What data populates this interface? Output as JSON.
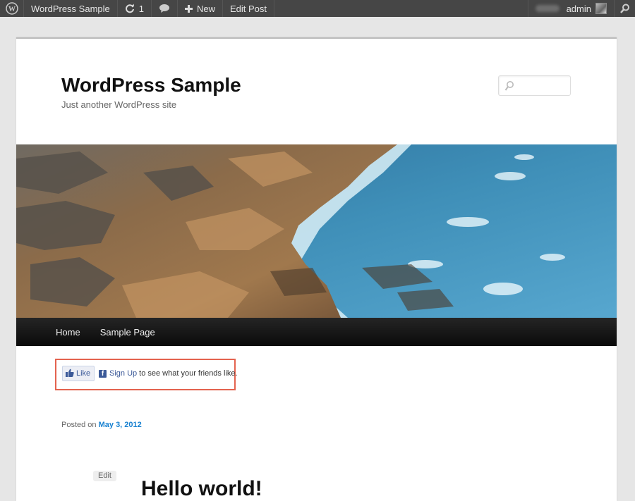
{
  "adminbar": {
    "logo_icon": "wordpress-icon",
    "site_name": "WordPress Sample",
    "updates_count": "1",
    "updates_icon": "refresh-icon",
    "comments_icon": "comment-icon",
    "new_label": "New",
    "new_icon": "plus-icon",
    "edit_label": "Edit Post",
    "user_name": "admin",
    "search_icon": "search-icon"
  },
  "site": {
    "title": "WordPress Sample",
    "description": "Just another WordPress site"
  },
  "nav": {
    "items": [
      {
        "label": "Home"
      },
      {
        "label": "Sample Page"
      }
    ]
  },
  "like_widget": {
    "like_label": "Like",
    "signup_link": "Sign Up",
    "signup_text": "to see what your friends like.",
    "highlight_color": "#e4634f"
  },
  "post": {
    "posted_prefix": "Posted on",
    "date": "May 3, 2012",
    "edit_label": "Edit",
    "title": "Hello world!"
  },
  "colors": {
    "adminbar_bg": "#464646",
    "link_blue": "#1982d1",
    "facebook_blue": "#3b5998",
    "nav_bg": "#1a1a1a"
  }
}
